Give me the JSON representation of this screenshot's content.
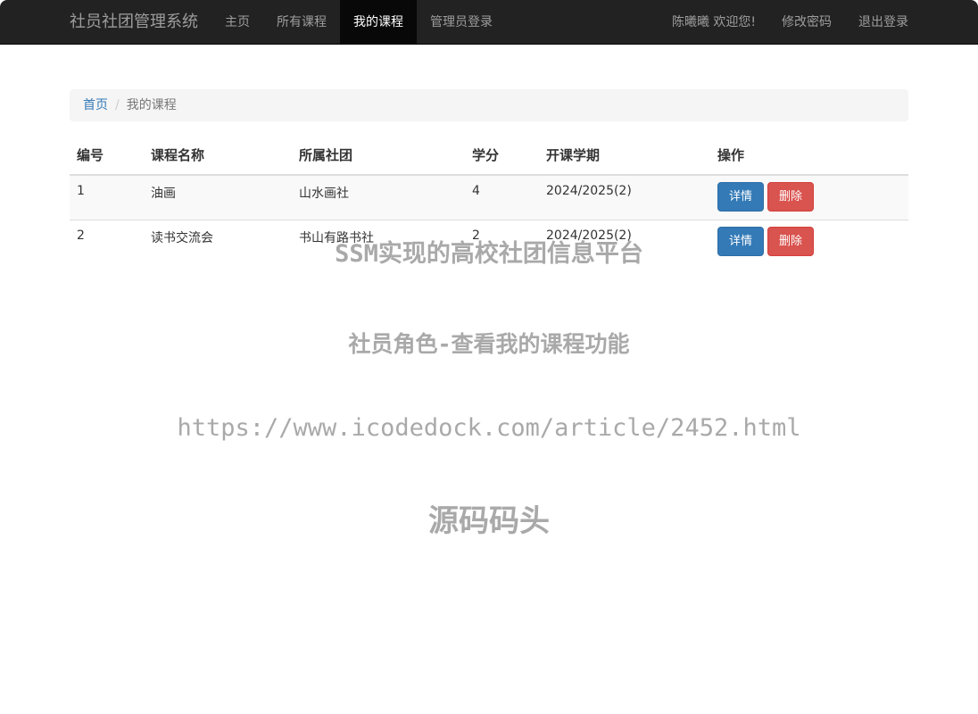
{
  "navbar": {
    "brand": "社员社团管理系统",
    "items": [
      {
        "label": "主页"
      },
      {
        "label": "所有课程"
      },
      {
        "label": "我的课程",
        "active": true
      },
      {
        "label": "管理员登录"
      }
    ],
    "welcome": "陈曦曦 欢迎您!",
    "change_password": "修改密码",
    "logout": "退出登录"
  },
  "breadcrumb": {
    "home": "首页",
    "separator": "/",
    "current": "我的课程"
  },
  "table": {
    "headers": [
      "编号",
      "课程名称",
      "所属社团",
      "学分",
      "开课学期",
      "操作"
    ],
    "rows": [
      {
        "id": "1",
        "name": "油画",
        "club": "山水画社",
        "credit": "4",
        "term": "2024/2025(2)"
      },
      {
        "id": "2",
        "name": "读书交流会",
        "club": "书山有路书社",
        "credit": "2",
        "term": "2024/2025(2)"
      }
    ],
    "detail_label": "详情",
    "delete_label": "删除"
  },
  "watermark": {
    "line1": "SSM实现的高校社团信息平台",
    "line2": "社员角色-查看我的课程功能",
    "line3": "https://www.icodedock.com/article/2452.html",
    "line4": "源码码头"
  },
  "colors": {
    "navbar_bg": "#222222",
    "primary": "#337ab7",
    "danger": "#d9534f"
  }
}
